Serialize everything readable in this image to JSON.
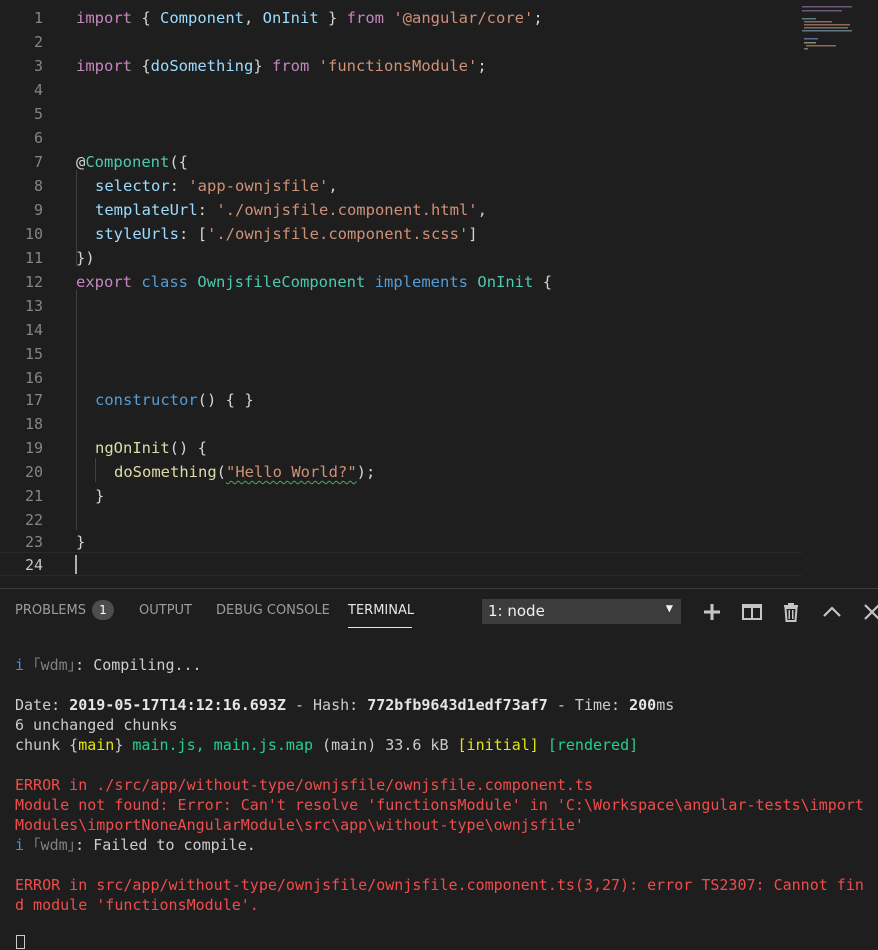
{
  "editor": {
    "line_numbers": [
      "1",
      "2",
      "3",
      "4",
      "5",
      "6",
      "7",
      "8",
      "9",
      "10",
      "11",
      "12",
      "13",
      "14",
      "15",
      "16",
      "17",
      "18",
      "19",
      "20",
      "21",
      "22",
      "23",
      "24"
    ],
    "l1": {
      "import": "import",
      "open": " { ",
      "component": "Component",
      "comma": ", ",
      "oninit": "OnInit",
      "close": " } ",
      "from": "from",
      "space": " ",
      "path": "'@angular/core'",
      "semi": ";"
    },
    "l3": {
      "import": "import",
      "open": " {",
      "name": "doSomething",
      "close": "} ",
      "from": "from",
      "space": " ",
      "path": "'functionsModule'",
      "semi": ";"
    },
    "l7": {
      "at": "@",
      "decorator": "Component",
      "paren": "({"
    },
    "l8": {
      "key": "selector",
      "colon": ": ",
      "value": "'app-ownjsfile'",
      "comma": ","
    },
    "l9": {
      "key": "templateUrl",
      "colon": ": ",
      "value": "'./ownjsfile.component.html'",
      "comma": ","
    },
    "l10": {
      "key": "styleUrls",
      "colon": ": [",
      "value": "'./ownjsfile.component.scss'",
      "close": "]"
    },
    "l11": {
      "text": "})"
    },
    "l12": {
      "export": "export",
      "class": "class",
      "name": "OwnjsfileComponent",
      "implements": "implements",
      "iface": "OnInit",
      "brace": " {"
    },
    "l17": {
      "ctor": "constructor",
      "rest": "() { }"
    },
    "l19": {
      "fn": "ngOnInit",
      "rest": "() {"
    },
    "l20": {
      "fn": "doSomething",
      "open": "(",
      "arg": "\"Hello World?\"",
      "close": ");"
    },
    "l21": {
      "text": "}"
    },
    "l23": {
      "text": "}"
    }
  },
  "panel": {
    "tabs": {
      "problems": "PROBLEMS",
      "problems_count": "1",
      "output": "OUTPUT",
      "debug": "DEBUG CONSOLE",
      "terminal": "TERMINAL"
    },
    "terminal_select": "1: node",
    "tools": {
      "add": "new-terminal",
      "split": "split-terminal",
      "kill": "kill-terminal",
      "maximize": "maximize-panel",
      "close": "close-panel"
    }
  },
  "terminal": {
    "t1": {
      "i": "i",
      "wdm": " ｢wdm｣",
      "msg": ": Compiling..."
    },
    "t3": {
      "date_label": "Date: ",
      "date": "2019-05-17T14:12:16.693Z",
      "sep1": " - Hash: ",
      "hash": "772bfb9643d1edf73af7",
      "sep2": " - Time: ",
      "time": "200",
      "ms": "ms"
    },
    "t4": "6 unchanged chunks",
    "t5": {
      "chunk": "chunk {",
      "main": "main",
      "close": "} ",
      "files": "main.js, main.js.map",
      "rest": " (main) 33.6 kB ",
      "initial": "[initial]",
      "sp": " ",
      "rendered": "[rendered]"
    },
    "t7": "ERROR in ./src/app/without-type/ownjsfile/ownjsfile.component.ts",
    "t8": "Module not found: Error: Can't resolve 'functionsModule' in 'C:\\Workspace\\angular-tests\\import",
    "t9": "Modules\\importNoneAngularModule\\src\\app\\without-type\\ownjsfile'",
    "t10": {
      "i": "i",
      "wdm": " ｢wdm｣",
      "msg": ": Failed to compile."
    },
    "t12": "ERROR in src/app/without-type/ownjsfile/ownjsfile.component.ts(3,27): error TS2307: Cannot fin",
    "t13": "d module 'functionsModule'."
  }
}
